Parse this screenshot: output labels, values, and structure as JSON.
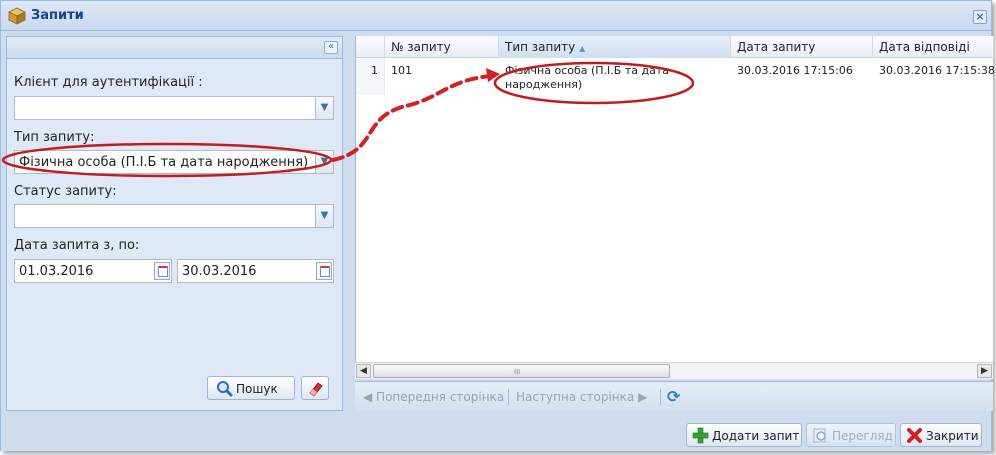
{
  "window": {
    "title": "Запити",
    "close_glyph": "×"
  },
  "left_panel": {
    "collapse_glyph": "«",
    "client_label": "Клієнт для аутентифікації :",
    "client_value": "",
    "type_label": "Тип запиту:",
    "type_value": "Фізична особа (П.І.Б та дата народження)",
    "status_label": "Статус запиту:",
    "status_value": "",
    "date_label": "Дата запита з, по:",
    "date_from": "01.03.2016",
    "date_to": "30.03.2016",
    "search_label": "Пошук"
  },
  "grid": {
    "columns": [
      "№ запиту",
      "Тип запиту",
      "Дата запиту",
      "Дата відповіді"
    ],
    "sorted_column": "Тип запиту",
    "sort_arrow": "▲",
    "rows": [
      {
        "row_number": "1",
        "request_no": "101",
        "type_line1": "Фізична особа (П.І.Б та дата",
        "type_line2": "народження)",
        "request_date": "30.03.2016 17:15:06",
        "response_date": "30.03.2016 17:15:38"
      }
    ]
  },
  "scrollbar": {
    "left_glyph": "◀",
    "right_glyph": "▶",
    "grip": "III"
  },
  "pager": {
    "prev_label": "◀  Попередня сторінка",
    "next_label": "Наступна сторінка  ▶",
    "refresh_glyph": "⟳"
  },
  "footer": {
    "add_label": "Додати запит",
    "view_label": "Перегляд",
    "close_label": "Закрити"
  },
  "colors": {
    "accent": "#15428b",
    "highlight": "#d32020",
    "panel": "#dfe8f6"
  }
}
